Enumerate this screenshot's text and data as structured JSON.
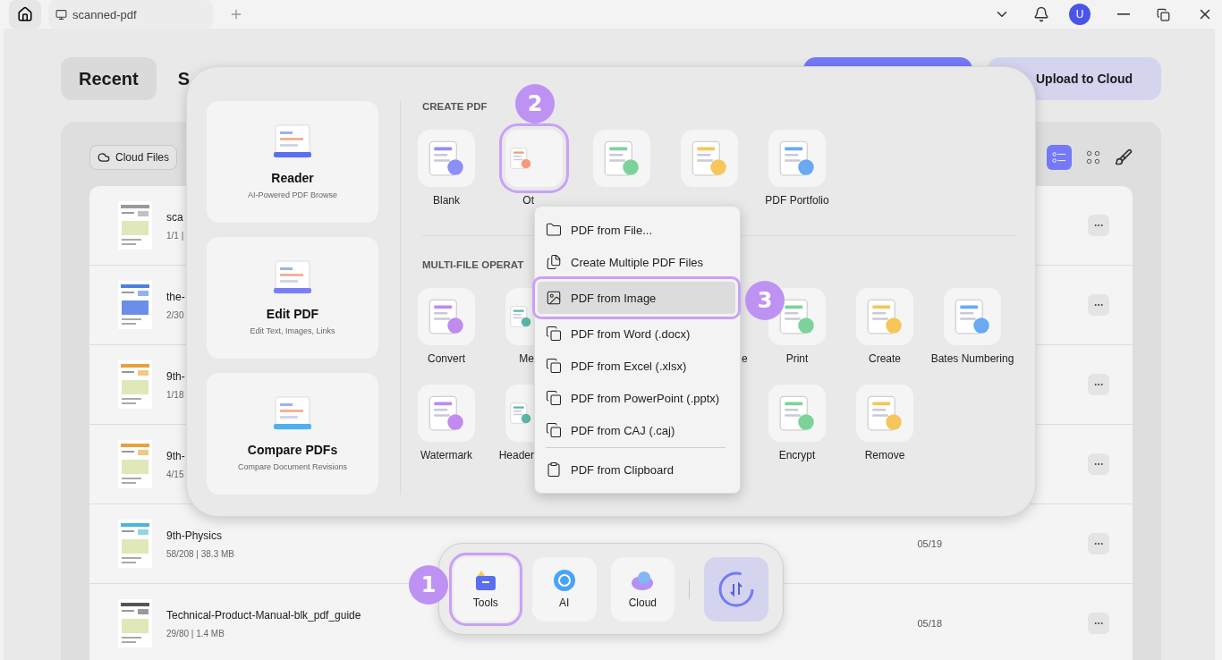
{
  "titlebar": {
    "tab_title": "scanned-pdf",
    "avatar": "U"
  },
  "page_tabs": [
    {
      "label": "Recent",
      "selected": true
    },
    {
      "label": "S",
      "selected": false
    }
  ],
  "upload_button": "Upload to Cloud",
  "cloud_files_button": "Cloud Files",
  "view_modes": [
    {
      "kind": "list",
      "selected": true
    },
    {
      "kind": "grid",
      "selected": false
    }
  ],
  "files": [
    {
      "name": "sca",
      "meta": "1/1 |"
    },
    {
      "name": "the-",
      "meta": "2/30"
    },
    {
      "name": "9th-",
      "meta": "1/18"
    },
    {
      "name": "9th-",
      "meta": "4/15"
    },
    {
      "name": "9th-Physics",
      "meta": "58/208 | 38.3 MB",
      "date": "05/19"
    },
    {
      "name": "Technical-Product-Manual-blk_pdf_guide",
      "meta": "29/80 | 1.4 MB",
      "date": "05/18"
    }
  ],
  "tools_panel": {
    "features": [
      {
        "title": "Reader",
        "subtitle": "AI-Powered PDF Browse"
      },
      {
        "title": "Edit PDF",
        "subtitle": "Edit Text, Images, Links"
      },
      {
        "title": "Compare PDFs",
        "subtitle": "Compare Document Revisions"
      }
    ],
    "create_heading": "CREATE PDF",
    "create_tools": [
      {
        "kind": "tile",
        "label": "Blank",
        "highlighted": false
      },
      {
        "kind": "clipped",
        "label": "Ot",
        "highlighted": true
      },
      {
        "kind": "tile",
        "highlighted": false
      },
      {
        "kind": "tile",
        "highlighted": false
      },
      {
        "kind": "tile",
        "label": "PDF Portfolio",
        "highlighted": false
      }
    ],
    "multi_heading": "MULTI-FILE OPERAT",
    "multi_tools": [
      {
        "kind": "tile",
        "label": "Convert",
        "highlighted": false
      },
      {
        "kind": "clipped",
        "label": "Me",
        "highlighted": false
      },
      {
        "kind": "covered"
      },
      {
        "kind": "covered",
        "label": "e"
      },
      {
        "kind": "tile",
        "label": "Print",
        "highlighted": false
      },
      {
        "kind": "tile",
        "label": "Create",
        "highlighted": false
      },
      {
        "kind": "tile",
        "label": "Bates Numbering",
        "highlighted": false
      },
      {
        "kind": "tile",
        "label": "Watermark",
        "highlighted": false
      },
      {
        "kind": "clipped",
        "label": "Header",
        "highlighted": false
      },
      {
        "kind": "covered"
      },
      {
        "kind": "covered"
      },
      {
        "kind": "tile",
        "label": "Encrypt",
        "highlighted": false
      },
      {
        "kind": "tile",
        "label": "Remove",
        "highlighted": false
      }
    ]
  },
  "create_menu": [
    {
      "label": "PDF from File...",
      "selected": false,
      "divider_above": false
    },
    {
      "label": "Create Multiple PDF Files",
      "selected": false,
      "divider_above": false
    },
    {
      "label": "PDF from Image",
      "selected": true,
      "divider_above": false
    },
    {
      "label": "PDF from Word (.docx)",
      "selected": false,
      "divider_above": false
    },
    {
      "label": "PDF from Excel (.xlsx)",
      "selected": false,
      "divider_above": false
    },
    {
      "label": "PDF from PowerPoint (.pptx)",
      "selected": false,
      "divider_above": false
    },
    {
      "label": "PDF from CAJ (.caj)",
      "selected": false,
      "divider_above": false
    },
    {
      "label": "PDF from Clipboard",
      "selected": false,
      "divider_above": true
    }
  ],
  "dock": [
    {
      "label": "Tools",
      "highlighted": true
    },
    {
      "label": "AI",
      "highlighted": false
    },
    {
      "label": "Cloud",
      "highlighted": false
    }
  ],
  "step_badges": [
    "1",
    "2",
    "3"
  ]
}
